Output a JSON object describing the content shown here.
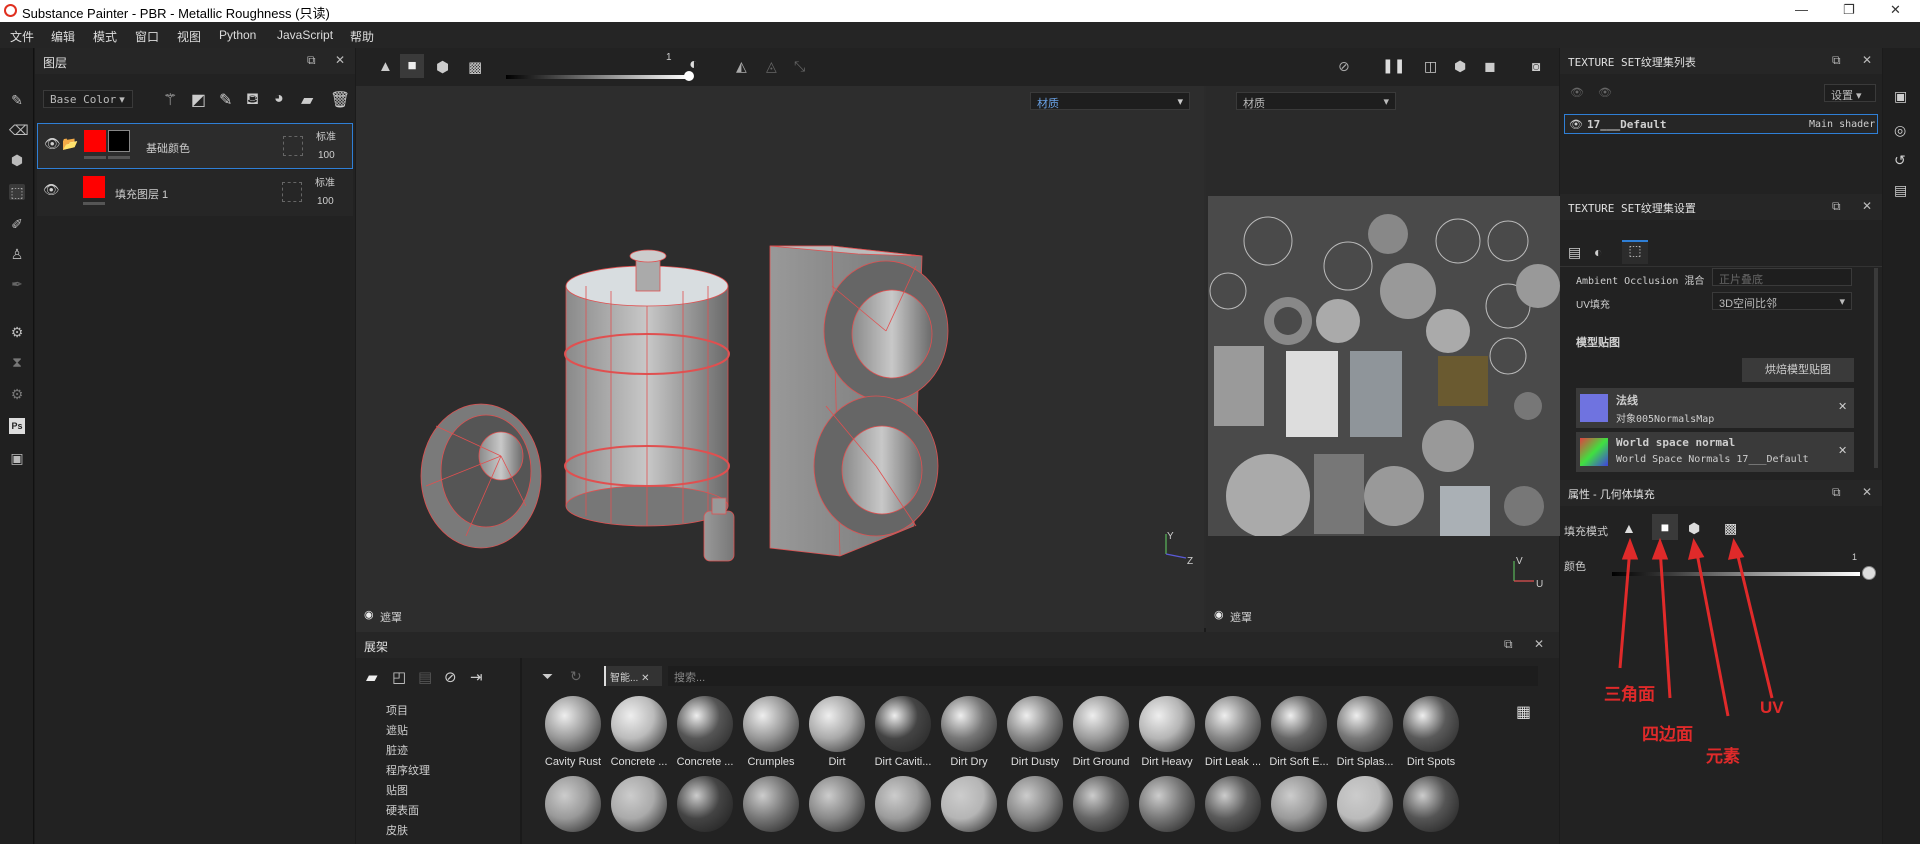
{
  "window": {
    "title": "Substance Painter - PBR - Metallic Roughness (只读)",
    "minimize": "—",
    "maximize": "❐",
    "close": "✕"
  },
  "menu": [
    "文件",
    "编辑",
    "模式",
    "窗口",
    "视图",
    "Python",
    "JavaScript",
    "帮助"
  ],
  "layers": {
    "title": "图层",
    "channel": "Base Color",
    "items": [
      {
        "name": "基础颜色",
        "blend": "标准",
        "opacity": "100"
      },
      {
        "name": "填充图层 1",
        "blend": "标准",
        "opacity": "100"
      }
    ]
  },
  "viewport": {
    "slider_value": "1",
    "dropdown_3d": "材质",
    "dropdown_2d": "材质",
    "mask_label_3d": "遮罩",
    "mask_label_2d": "遮罩",
    "axis_y": "Y",
    "axis_z": "Z",
    "axis_v": "V",
    "axis_u": "U"
  },
  "shelf": {
    "title": "展架",
    "tree": [
      "项目",
      "遮贴",
      "脏迹",
      "程序纹理",
      "贴图",
      "硬表面",
      "皮肤",
      "..."
    ],
    "filter_tag": "智能...",
    "search_placeholder": "搜索...",
    "materials_row1": [
      "Cavity Rust",
      "Concrete ...",
      "Concrete ...",
      "Crumples",
      "Dirt",
      "Dirt Caviti...",
      "Dirt Dry",
      "Dirt Dusty",
      "Dirt Ground",
      "Dirt Heavy",
      "Dirt Leak ...",
      "Dirt Soft E...",
      "Dirt Splas...",
      "Dirt Spots"
    ]
  },
  "texture_set_list": {
    "title": "TEXTURE SET纹理集列表",
    "settings_btn": "设置",
    "item_name": "17___Default",
    "item_shader": "Main shader"
  },
  "texture_set_settings": {
    "title": "TEXTURE SET纹理集设置",
    "ao_label": "Ambient Occlusion 混合",
    "ao_value": "正片叠底",
    "uv_label": "UV填充",
    "uv_value": "3D空间比邻",
    "mesh_maps_title": "模型贴图",
    "bake_btn": "烘焙模型贴图",
    "maps": [
      {
        "name": "法线",
        "source": "对象005NormalsMap"
      },
      {
        "name": "World space normal",
        "source": "World Space Normals 17___Default"
      }
    ]
  },
  "properties": {
    "title": "属性 - 几何体填充",
    "fill_mode_label": "填充模式",
    "color_label": "颜色",
    "slider_value": "1"
  },
  "annotations": {
    "triangle": "三角面",
    "quad": "四边面",
    "element": "元素",
    "uv": "UV"
  },
  "colors": {
    "accent": "#2f7fd6",
    "red_swatch": "#ff0000",
    "annotation": "#e02a2a",
    "wire": "#e05050"
  }
}
